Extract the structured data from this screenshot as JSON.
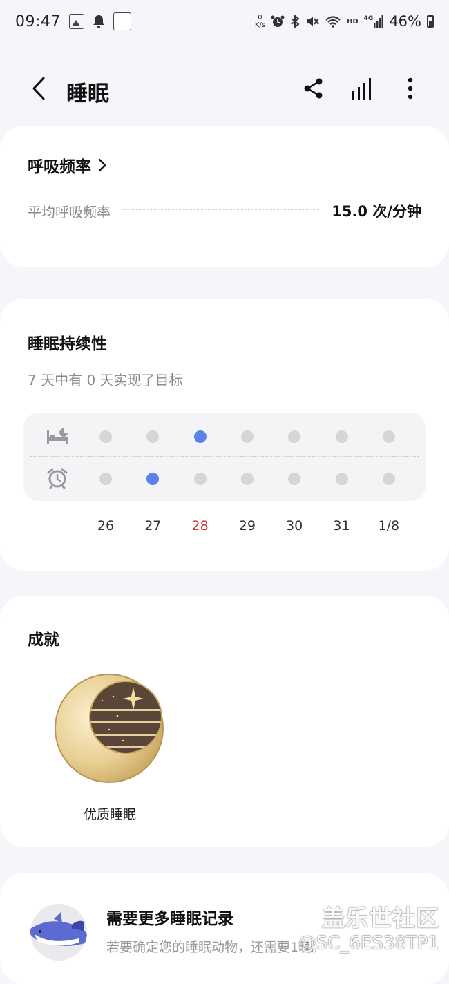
{
  "status_bar": {
    "time": "09:47",
    "net_speed_value": "0",
    "net_speed_unit": "K/s",
    "hd": "HD",
    "net_type": "4G",
    "battery": "46%"
  },
  "header": {
    "title": "睡眠",
    "icons": [
      "back-icon",
      "share-icon",
      "chart-icon",
      "more-icon"
    ]
  },
  "respiratory": {
    "title": "呼吸频率",
    "avg_label": "平均呼吸频率",
    "avg_value": "15.0 次/分钟"
  },
  "consistency": {
    "title": "睡眠持续性",
    "subtitle": "7 天中有 0 天实现了目标",
    "days": [
      "26",
      "27",
      "28",
      "29",
      "30",
      "31",
      "1/8"
    ],
    "today_index": 2,
    "bedtime_met": [
      false,
      false,
      true,
      false,
      false,
      false,
      false
    ],
    "wakeup_met": [
      false,
      true,
      false,
      false,
      false,
      false,
      false
    ],
    "active_color": "#5b82ea",
    "inactive_color": "#d6d6d8",
    "today_color": "#d0393c"
  },
  "achievements": {
    "title": "成就",
    "badge_label": "优质睡眠"
  },
  "more_records": {
    "title": "需要更多睡眠记录",
    "subtitle": "若要确定您的睡眠动物，还需要1晚。"
  },
  "watermark": {
    "brand": "盖乐世社区",
    "user": "@SC_6ES38TP1"
  }
}
